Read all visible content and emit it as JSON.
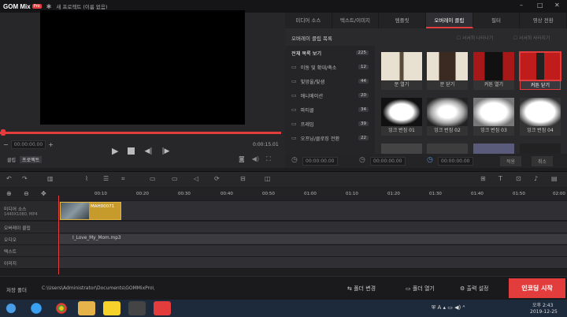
{
  "titlebar": {
    "logo": "GOM Mix",
    "pro": "Pro",
    "project_title": "새 프로젝트 (이름 없음)"
  },
  "preview": {
    "time_current": "00:00:00.00",
    "time_total": "0:00:15.01",
    "clip_label": "클립",
    "project_label": "프로젝트"
  },
  "tabs": [
    "미디어 소스",
    "텍스트/이미지",
    "템플릿",
    "오버레이 클립",
    "필터",
    "영상 전환"
  ],
  "overlay": {
    "list_title": "오버레이 클립 목록",
    "opt1": "서서히 나타나기",
    "opt2": "서서히 사라지기",
    "categories": [
      {
        "label": "전체 목록 보기",
        "count": "225"
      },
      {
        "label": "이동 및 확대/축소",
        "count": "12"
      },
      {
        "label": "빛망울/빛샘",
        "count": "44"
      },
      {
        "label": "애니메이션",
        "count": "20"
      },
      {
        "label": "파티클",
        "count": "34"
      },
      {
        "label": "프레임",
        "count": "39"
      },
      {
        "label": "오프닝/클로징 전환",
        "count": "22"
      }
    ],
    "thumbs": [
      {
        "label": "문 열기"
      },
      {
        "label": "문 닫기"
      },
      {
        "label": "커튼 열기"
      },
      {
        "label": "커튼 닫기"
      },
      {
        "label": "잉크 번짐 01"
      },
      {
        "label": "잉크 번짐 02"
      },
      {
        "label": "잉크 번짐 03"
      },
      {
        "label": "잉크 번짐 04"
      }
    ],
    "time1": "00:00:00.00",
    "time2": "00:00:00.00",
    "time3": "00:00:00.00",
    "apply": "적용",
    "cancel": "취소"
  },
  "timeline": {
    "ticks": [
      "00:10",
      "00:20",
      "00:30",
      "00:40",
      "00:50",
      "01:00",
      "01:10",
      "01:20",
      "01:30",
      "01:40",
      "01:50",
      "02:00"
    ],
    "tracks": [
      {
        "label": "미디어 소스",
        "sub": "1440X1080, MP4"
      },
      {
        "label": "오버레이 클립"
      },
      {
        "label": "오디오"
      },
      {
        "label": "텍스트"
      },
      {
        "label": "이미지"
      }
    ],
    "video_clip_name": "MAH00071",
    "audio_clip_name": "I_Love_My_Mom.mp3"
  },
  "bottom": {
    "save_folder_label": "저장 폴더",
    "save_path": "C:\\Users\\Administrator\\Documents\\GOMMixPro\\",
    "change_folder": "폴더 변경",
    "open_folder": "폴더 열기",
    "output_settings": "출력 설정",
    "encode": "인코딩 시작"
  },
  "taskbar": {
    "ampm": "오후 2:43",
    "date": "2019-12-25"
  },
  "colors": {
    "accent": "#e23c3c",
    "bg": "#1e1e20"
  }
}
